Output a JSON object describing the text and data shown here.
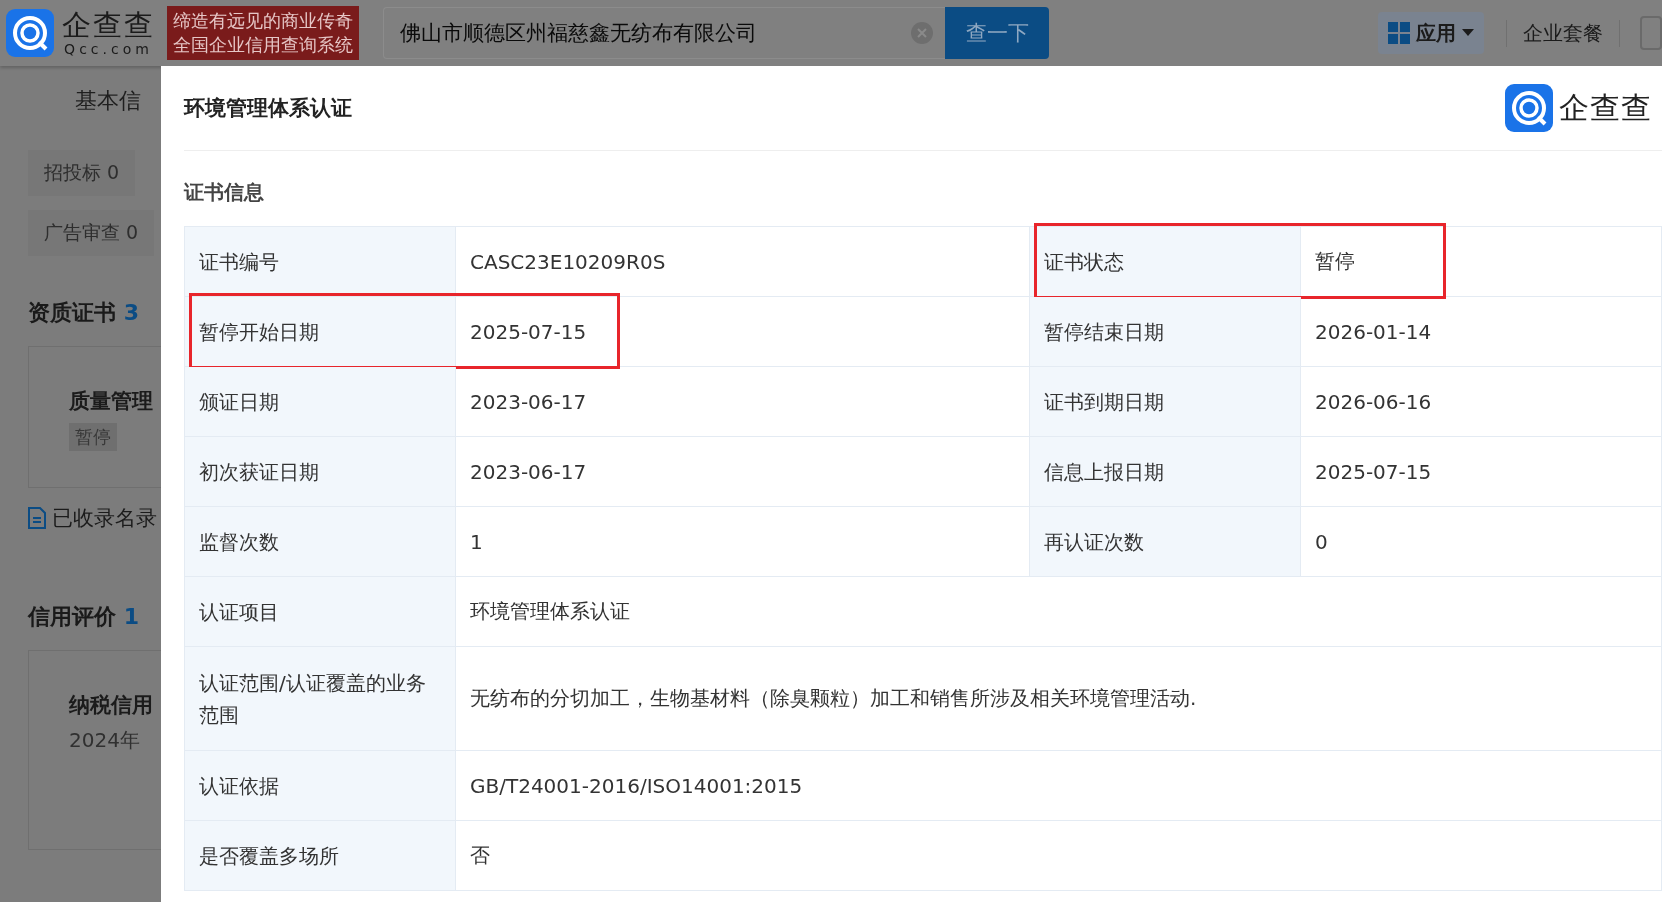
{
  "header": {
    "logo": {
      "name": "企查查",
      "domain": "Qcc.com"
    },
    "slogan": [
      "缔造有远见的商业传奇",
      "全国企业信用查询系统"
    ],
    "search": {
      "value": "佛山市顺德区州福慈鑫无纺布有限公司"
    },
    "search_button": "查一下",
    "menu": [
      {
        "label": "应用",
        "kind": "apps"
      },
      {
        "label": "企业套餐",
        "kind": "link"
      }
    ]
  },
  "background": {
    "tab": "基本信",
    "chips": [
      "招投标 0",
      "广告审查 0"
    ],
    "cert_heading": {
      "title": "资质证书",
      "count": "3"
    },
    "cert_card": {
      "title": "质量管理",
      "status": "暂停"
    },
    "record_link": "已收录名录",
    "credit_heading": {
      "title": "信用评价",
      "count": "1"
    },
    "credit_card": {
      "title": "纳税信用",
      "year": "2024年"
    }
  },
  "dialog": {
    "title": "环境管理体系认证",
    "brand": "企查查",
    "section": "证书信息",
    "rows": [
      {
        "cells": [
          {
            "label": "证书编号",
            "value": "CASC23E10209R0S",
            "highlighted": false
          },
          {
            "label": "证书状态",
            "value": "暂停",
            "highlighted": true
          }
        ]
      },
      {
        "cells": [
          {
            "label": "暂停开始日期",
            "value": "2025-07-15",
            "highlighted": true
          },
          {
            "label": "暂停结束日期",
            "value": "2026-01-14",
            "highlighted": false
          }
        ]
      },
      {
        "cells": [
          {
            "label": "颁证日期",
            "value": "2023-06-17",
            "highlighted": false
          },
          {
            "label": "证书到期日期",
            "value": "2026-06-16",
            "highlighted": false
          }
        ]
      },
      {
        "cells": [
          {
            "label": "初次获证日期",
            "value": "2023-06-17",
            "highlighted": false
          },
          {
            "label": "信息上报日期",
            "value": "2025-07-15",
            "highlighted": false
          }
        ]
      },
      {
        "cells": [
          {
            "label": "监督次数",
            "value": "1",
            "highlighted": false
          },
          {
            "label": "再认证次数",
            "value": "0",
            "highlighted": false
          }
        ]
      },
      {
        "cells": [
          {
            "label": "认证项目",
            "value": "环境管理体系认证",
            "highlighted": false
          }
        ]
      },
      {
        "cells": [
          {
            "label": "认证范围/认证覆盖的业务范围",
            "value": "无纺布的分切加工，生物基材料（除臭颗粒）加工和销售所涉及相关环境管理活动.",
            "highlighted": false
          }
        ]
      },
      {
        "cells": [
          {
            "label": "认证依据",
            "value": "GB/T24001-2016/ISO14001:2015",
            "highlighted": false
          }
        ]
      },
      {
        "cells": [
          {
            "label": "是否覆盖多场所",
            "value": "否",
            "highlighted": false
          }
        ]
      }
    ]
  }
}
